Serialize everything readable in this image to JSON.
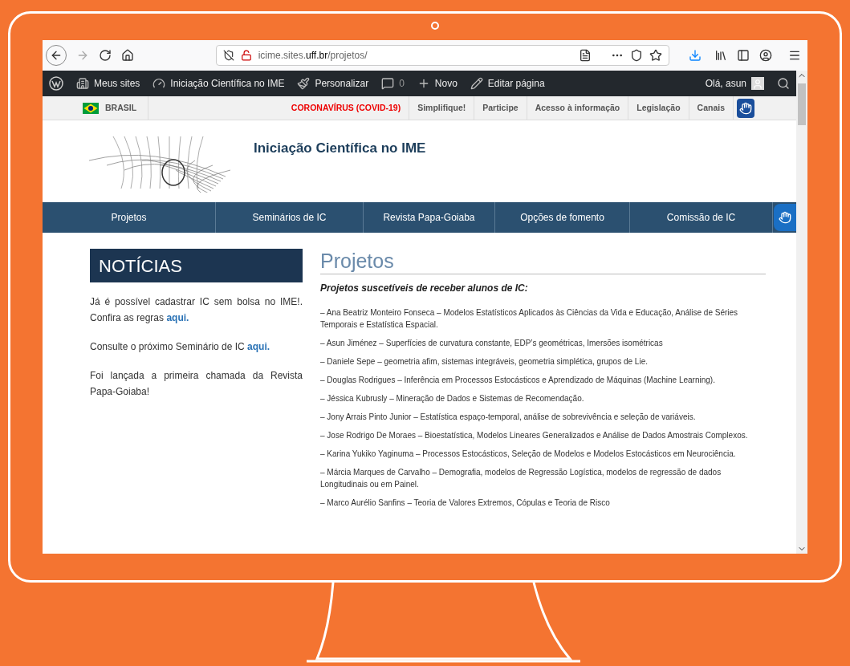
{
  "browser": {
    "url": "icime.sites.**uff.br**/projetos/"
  },
  "admin_bar": {
    "items": [
      {
        "kind": "sites",
        "label": "Meus sites"
      },
      {
        "kind": "dashboard",
        "label": "Iniciação Científica no IME"
      },
      {
        "kind": "customize",
        "label": "Personalizar"
      },
      {
        "kind": "comments",
        "label": "0"
      },
      {
        "kind": "new",
        "label": "Novo"
      },
      {
        "kind": "edit",
        "label": "Editar página"
      }
    ],
    "greeting": "Olá, asun"
  },
  "gov_bar": {
    "country": "BRASIL",
    "links": [
      {
        "label": "CORONAVÍRUS (COVID-19)",
        "kind": "alert"
      },
      {
        "label": "Simplifique!",
        "kind": "normal"
      },
      {
        "label": "Participe",
        "kind": "normal"
      },
      {
        "label": "Acesso à informação",
        "kind": "normal"
      },
      {
        "label": "Legislação",
        "kind": "normal"
      },
      {
        "label": "Canais",
        "kind": "normal"
      }
    ]
  },
  "site_title": "Iniciação Científica no IME",
  "nav": [
    "Projetos",
    "Seminários de IC",
    "Revista Papa-Goiaba",
    "Opções de fomento",
    "Comissão de IC"
  ],
  "sidebar": {
    "heading": "NOTÍCIAS",
    "paragraphs": [
      {
        "text": "Já é possível cadastrar IC sem bolsa no IME!. Confira as regras",
        "link": "aqui."
      },
      {
        "text": "Consulte o próximo Seminário de IC",
        "link": "aqui."
      },
      {
        "text": "Foi lançada a primeira chamada da Revista Papa-Goiaba!"
      }
    ]
  },
  "page": {
    "title": "Projetos",
    "subtitle": "Projetos suscetíveis de receber alunos de IC:",
    "projects": [
      "– Ana Beatriz Monteiro Fonseca – Modelos Estatísticos Aplicados às Ciências da Vida e Educação, Análise de Séries Temporais e Estatística Espacial.",
      "– Asun Jiménez – Superfícies de curvatura constante, EDP’s geométricas, Imersões isométricas",
      "– Daniele Sepe – geometria afim, sistemas integráveis, geometria simplética, grupos de Lie.",
      "– Douglas Rodrigues – Inferência em Processos Estocásticos e Aprendizado de Máquinas (Machine Learning).",
      "– Jéssica Kubrusly – Mineração de Dados e Sistemas de Recomendação.",
      "– Jony Arrais Pinto Junior – Estatística espaço-temporal, análise de sobrevivência e seleção de variáveis.",
      "– Jose Rodrigo De Moraes – Bioestatística, Modelos Lineares Generalizados e Análise de Dados Amostrais Complexos.",
      "– Karina Yukiko Yaginuma – Processos Estocásticos, Seleção de Modelos e Modelos Estocásticos em Neurociência.",
      "– Márcia Marques de Carvalho – Demografia, modelos de Regressão Logística, modelos de regressão de dados Longitudinais ou em Painel.",
      "– Marco Aurélio Sanfins – Teoria de Valores Extremos, Cópulas e Teoria de Risco"
    ]
  }
}
